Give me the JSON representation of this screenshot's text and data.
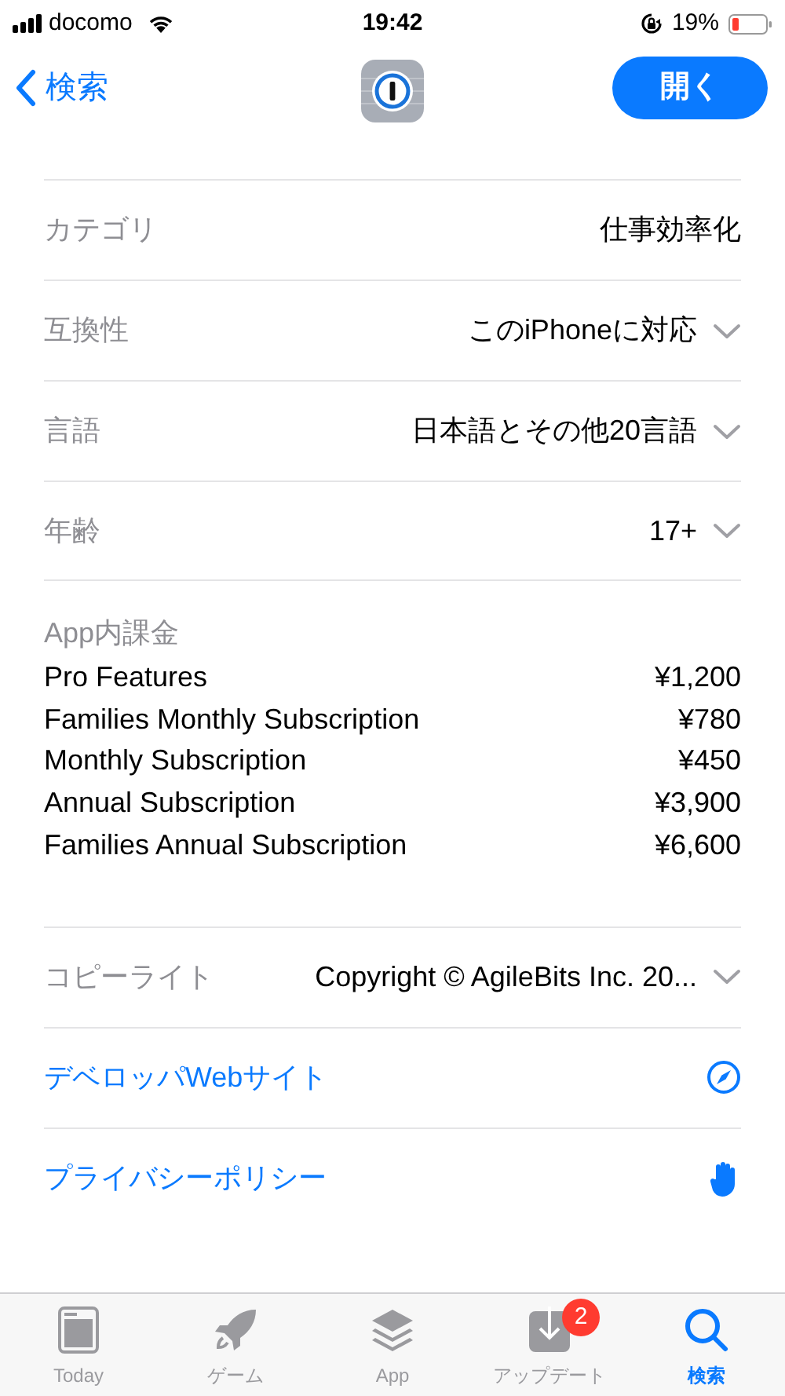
{
  "status_bar": {
    "carrier": "docomo",
    "time": "19:42",
    "battery": "19%"
  },
  "nav": {
    "back": "検索",
    "open_button": "開く"
  },
  "info_rows": [
    {
      "label": "カテゴリ",
      "value": "仕事効率化",
      "expandable": false
    },
    {
      "label": "互換性",
      "value": "このiPhoneに対応",
      "expandable": true
    },
    {
      "label": "言語",
      "value": "日本語とその他20言語",
      "expandable": true
    },
    {
      "label": "年齢",
      "value": "17+",
      "expandable": true
    }
  ],
  "in_app_purchases": {
    "title": "App内課金",
    "items": [
      {
        "name": "Pro Features",
        "price": "¥1,200"
      },
      {
        "name": "Families Monthly Subscription",
        "price": "¥780"
      },
      {
        "name": "Monthly Subscription",
        "price": "¥450"
      },
      {
        "name": "Annual Subscription",
        "price": "¥3,900"
      },
      {
        "name": "Families Annual Subscription",
        "price": "¥6,600"
      }
    ]
  },
  "copyright": {
    "label": "コピーライト",
    "value": "Copyright © AgileBits Inc. 20...",
    "expandable": true
  },
  "links": [
    {
      "kind": "website",
      "label": "デベロッパWebサイト"
    },
    {
      "kind": "privacy",
      "label": "プライバシーポリシー"
    }
  ],
  "tabs": [
    {
      "kind": "today",
      "label": "Today",
      "selected": false
    },
    {
      "kind": "games",
      "label": "ゲーム",
      "selected": false
    },
    {
      "kind": "apps",
      "label": "App",
      "selected": false
    },
    {
      "kind": "updates",
      "label": "アップデート",
      "selected": false,
      "badge": "2"
    },
    {
      "kind": "search",
      "label": "検索",
      "selected": true
    }
  ]
}
